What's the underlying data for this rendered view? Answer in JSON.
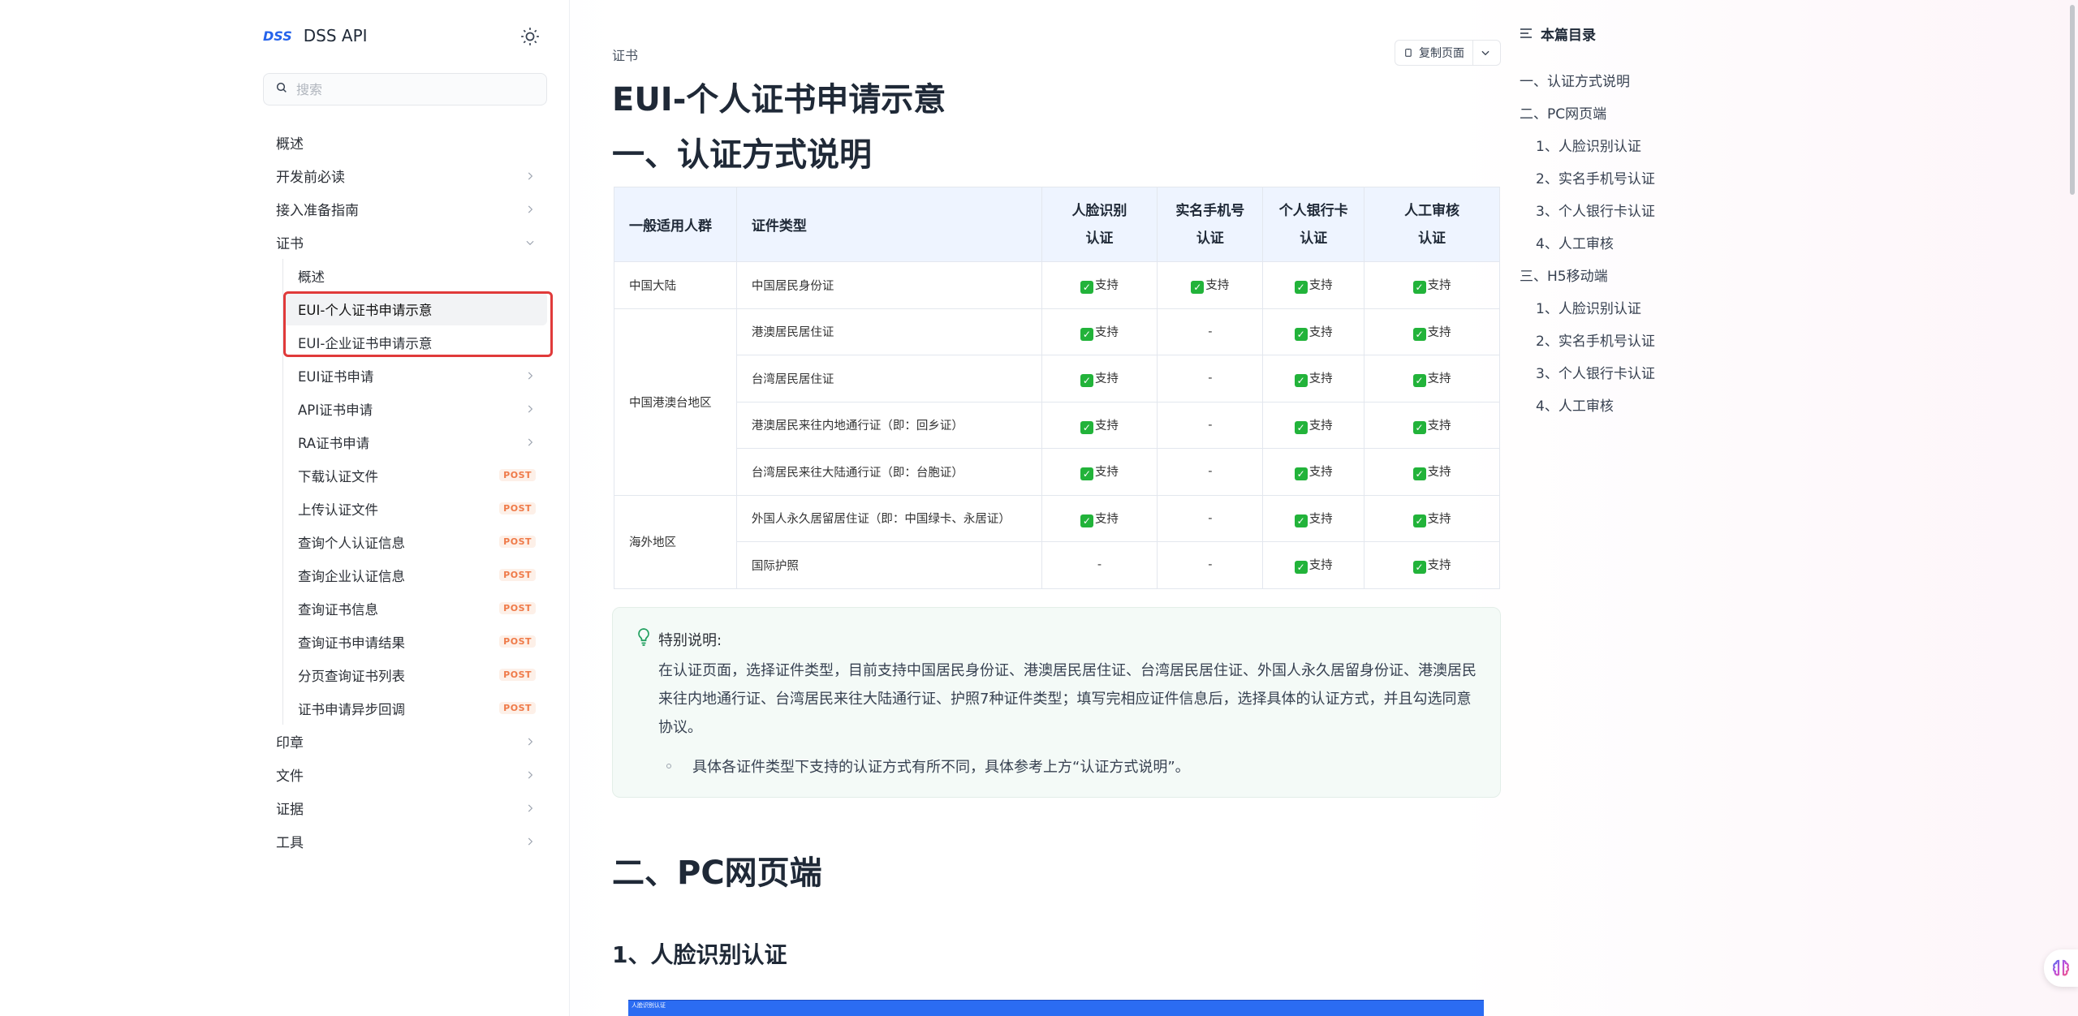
{
  "sidebar": {
    "brand_logo": "DSS",
    "brand_name": "DSS API",
    "search_placeholder": "搜索",
    "items": [
      {
        "label": "概述",
        "chevron": false
      },
      {
        "label": "开发前必读",
        "chevron": true
      },
      {
        "label": "接入准备指南",
        "chevron": true
      },
      {
        "label": "证书",
        "chevron": true,
        "expanded": true
      }
    ],
    "cert_children": [
      {
        "label": "概述"
      },
      {
        "label": "EUI-个人证书申请示意",
        "active": true
      },
      {
        "label": "EUI-企业证书申请示意"
      },
      {
        "label": "EUI证书申请",
        "chevron": true
      },
      {
        "label": "API证书申请",
        "chevron": true
      },
      {
        "label": "RA证书申请",
        "chevron": true
      },
      {
        "label": "下载认证文件",
        "badge": "POST"
      },
      {
        "label": "上传认证文件",
        "badge": "POST"
      },
      {
        "label": "查询个人认证信息",
        "badge": "POST"
      },
      {
        "label": "查询企业认证信息",
        "badge": "POST"
      },
      {
        "label": "查询证书信息",
        "badge": "POST"
      },
      {
        "label": "查询证书申请结果",
        "badge": "POST"
      },
      {
        "label": "分页查询证书列表",
        "badge": "POST"
      },
      {
        "label": "证书申请异步回调",
        "badge": "POST"
      }
    ],
    "bottom_items": [
      {
        "label": "印章"
      },
      {
        "label": "文件"
      },
      {
        "label": "证据"
      },
      {
        "label": "工具"
      }
    ]
  },
  "main": {
    "breadcrumb": "证书",
    "copy_button": "复制页面",
    "title": "EUI-个人证书申请示意",
    "section1": "一、认证方式说明",
    "table": {
      "headers": [
        "一般适用人群",
        "证件类型",
        "人脸识别\n认证",
        "实名手机号\n认证",
        "个人银行卡\n认证",
        "人工审核\n认证"
      ],
      "support_text": "支持",
      "groups": [
        {
          "group": "中国大陆",
          "rows": [
            {
              "doc": "中国居民身份证",
              "cells": [
                "支持",
                "支持",
                "支持",
                "支持"
              ]
            }
          ]
        },
        {
          "group": "中国港澳台地区",
          "rows": [
            {
              "doc": "港澳居民居住证",
              "cells": [
                "支持",
                "-",
                "支持",
                "支持"
              ]
            },
            {
              "doc": "台湾居民居住证",
              "cells": [
                "支持",
                "-",
                "支持",
                "支持"
              ]
            },
            {
              "doc": "港澳居民来往内地通行证（即：回乡证）",
              "cells": [
                "支持",
                "-",
                "支持",
                "支持"
              ]
            },
            {
              "doc": "台湾居民来往大陆通行证（即：台胞证）",
              "cells": [
                "支持",
                "-",
                "支持",
                "支持"
              ]
            }
          ]
        },
        {
          "group": "海外地区",
          "rows": [
            {
              "doc": "外国人永久居留居住证（即：中国绿卡、永居证）",
              "cells": [
                "支持",
                "-",
                "支持",
                "支持"
              ]
            },
            {
              "doc": "国际护照",
              "cells": [
                "-",
                "-",
                "支持",
                "支持"
              ]
            }
          ]
        }
      ]
    },
    "note": {
      "heading": "特别说明:",
      "body": "在认证页面，选择证件类型，目前支持中国居民身份证、港澳居民居住证、台湾居民居住证、外国人永久居留身份证、港澳居民来往内地通行证、台湾居民来往大陆通行证、护照7种证件类型；填写完相应证件信息后，选择具体的认证方式，并且勾选同意协议。",
      "bullet": "具体各证件类型下支持的认证方式有所不同，具体参考上方“认证方式说明”。"
    },
    "section2": "二、PC网页端",
    "subsection1": "1、人脸识别认证",
    "preview_caption": "人脸识别认证"
  },
  "toc": {
    "heading": "本篇目录",
    "items": [
      {
        "label": "一、认证方式说明",
        "indent": false
      },
      {
        "label": "二、PC网页端",
        "indent": false
      },
      {
        "label": "1、人脸识别认证",
        "indent": true
      },
      {
        "label": "2、实名手机号认证",
        "indent": true
      },
      {
        "label": "3、个人银行卡认证",
        "indent": true
      },
      {
        "label": "4、人工审核",
        "indent": true
      },
      {
        "label": "三、H5移动端",
        "indent": false
      },
      {
        "label": "1、人脸识别认证",
        "indent": true
      },
      {
        "label": "2、实名手机号认证",
        "indent": true
      },
      {
        "label": "3、个人银行卡认证",
        "indent": true
      },
      {
        "label": "4、人工审核",
        "indent": true
      }
    ]
  },
  "colors": {
    "accent": "#2563eb",
    "highlight_border": "#e03a3a",
    "post_badge": "#ef7a48",
    "check_green": "#22b33a",
    "table_header_bg": "#eef4ff",
    "note_bg": "#f4faf7"
  },
  "icons": {
    "theme": "sun-icon",
    "search": "search-icon",
    "chevron": "chevron-right-icon",
    "copy": "copy-icon",
    "dropdown": "chevron-down-icon",
    "note": "lightbulb-icon",
    "toc": "list-icon",
    "fab": "brain-icon"
  }
}
